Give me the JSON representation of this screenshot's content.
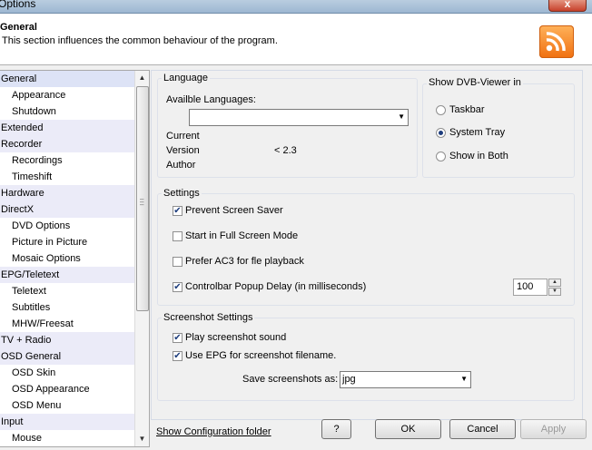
{
  "window": {
    "title": "Options",
    "close_label": "x"
  },
  "header": {
    "title": "General",
    "description": "This section influences the common behaviour of the program.",
    "logo_icon": "rss-icon"
  },
  "tree": {
    "items": [
      {
        "label": "General",
        "level": 0,
        "selected": true
      },
      {
        "label": "Appearance",
        "level": 1
      },
      {
        "label": "Shutdown",
        "level": 1
      },
      {
        "label": "Extended",
        "level": 0
      },
      {
        "label": "Recorder",
        "level": 0
      },
      {
        "label": "Recordings",
        "level": 1
      },
      {
        "label": "Timeshift",
        "level": 1
      },
      {
        "label": "Hardware",
        "level": 0
      },
      {
        "label": "DirectX",
        "level": 0
      },
      {
        "label": "DVD Options",
        "level": 1
      },
      {
        "label": "Picture in Picture",
        "level": 1
      },
      {
        "label": "Mosaic Options",
        "level": 1
      },
      {
        "label": "EPG/Teletext",
        "level": 0
      },
      {
        "label": "Teletext",
        "level": 1
      },
      {
        "label": "Subtitles",
        "level": 1
      },
      {
        "label": "MHW/Freesat",
        "level": 1
      },
      {
        "label": "TV + Radio",
        "level": 0
      },
      {
        "label": "OSD General",
        "level": 0
      },
      {
        "label": "OSD Skin",
        "level": 1
      },
      {
        "label": "OSD Appearance",
        "level": 1
      },
      {
        "label": "OSD Menu",
        "level": 1
      },
      {
        "label": "Input",
        "level": 0
      },
      {
        "label": "Mouse",
        "level": 1
      }
    ]
  },
  "language": {
    "group_label": "Language",
    "available_label": "Availble Languages:",
    "dropdown_value": "",
    "current_label": "Current",
    "version_label": "Version",
    "version_value": "< 2.3",
    "author_label": "Author"
  },
  "show_in": {
    "group_label": "Show DVB-Viewer in",
    "options": [
      {
        "label": "Taskbar",
        "checked": false
      },
      {
        "label": "System Tray",
        "checked": true
      },
      {
        "label": "Show in Both",
        "checked": false
      }
    ]
  },
  "settings": {
    "group_label": "Settings",
    "options": [
      {
        "label": "Prevent Screen Saver",
        "checked": true
      },
      {
        "label": "Start in Full Screen Mode",
        "checked": false
      },
      {
        "label": "Prefer AC3 for fle playback",
        "checked": false
      },
      {
        "label": "Controlbar Popup Delay (in milliseconds)",
        "checked": true
      }
    ],
    "delay_value": "100"
  },
  "screenshot": {
    "group_label": "Screenshot Settings",
    "options": [
      {
        "label": "Play screenshot sound",
        "checked": true
      },
      {
        "label": "Use EPG for screenshot filename.",
        "checked": true
      }
    ],
    "save_as_label": "Save screenshots as:",
    "format_value": "jpg"
  },
  "footer": {
    "config_link": "Show Configuration folder",
    "help_label": "?",
    "ok_label": "OK",
    "cancel_label": "Cancel",
    "apply_label": "Apply"
  }
}
